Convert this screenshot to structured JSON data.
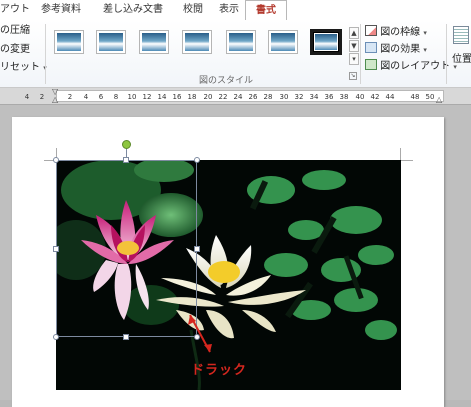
{
  "tabs": [
    "アウト",
    "参考資料",
    "差し込み文書",
    "校閲",
    "表示",
    "書式"
  ],
  "ribbon": {
    "adjust": {
      "compress": "の圧縮",
      "change": "の変更",
      "reset": "リセット"
    },
    "styles_group_label": "図のスタイル",
    "picture_border": "図の枠線",
    "picture_effects": "図の効果",
    "picture_layout": "図のレイアウト",
    "position": "位置"
  },
  "ruler": {
    "ticks": [
      "4",
      "2",
      "2",
      "4",
      "6",
      "8",
      "10",
      "12",
      "14",
      "16",
      "18",
      "20",
      "22",
      "24",
      "26",
      "28",
      "30",
      "32",
      "34",
      "36",
      "38",
      "40",
      "42",
      "44",
      "48",
      "50"
    ]
  },
  "annotation": {
    "drag_label": "ドラック"
  },
  "colors": {
    "active_tab_text": "#b33a2e",
    "selection_handle": "#7d8aa0",
    "rotate_handle": "#8dc63f",
    "drag_arrow": "#d5271f"
  }
}
